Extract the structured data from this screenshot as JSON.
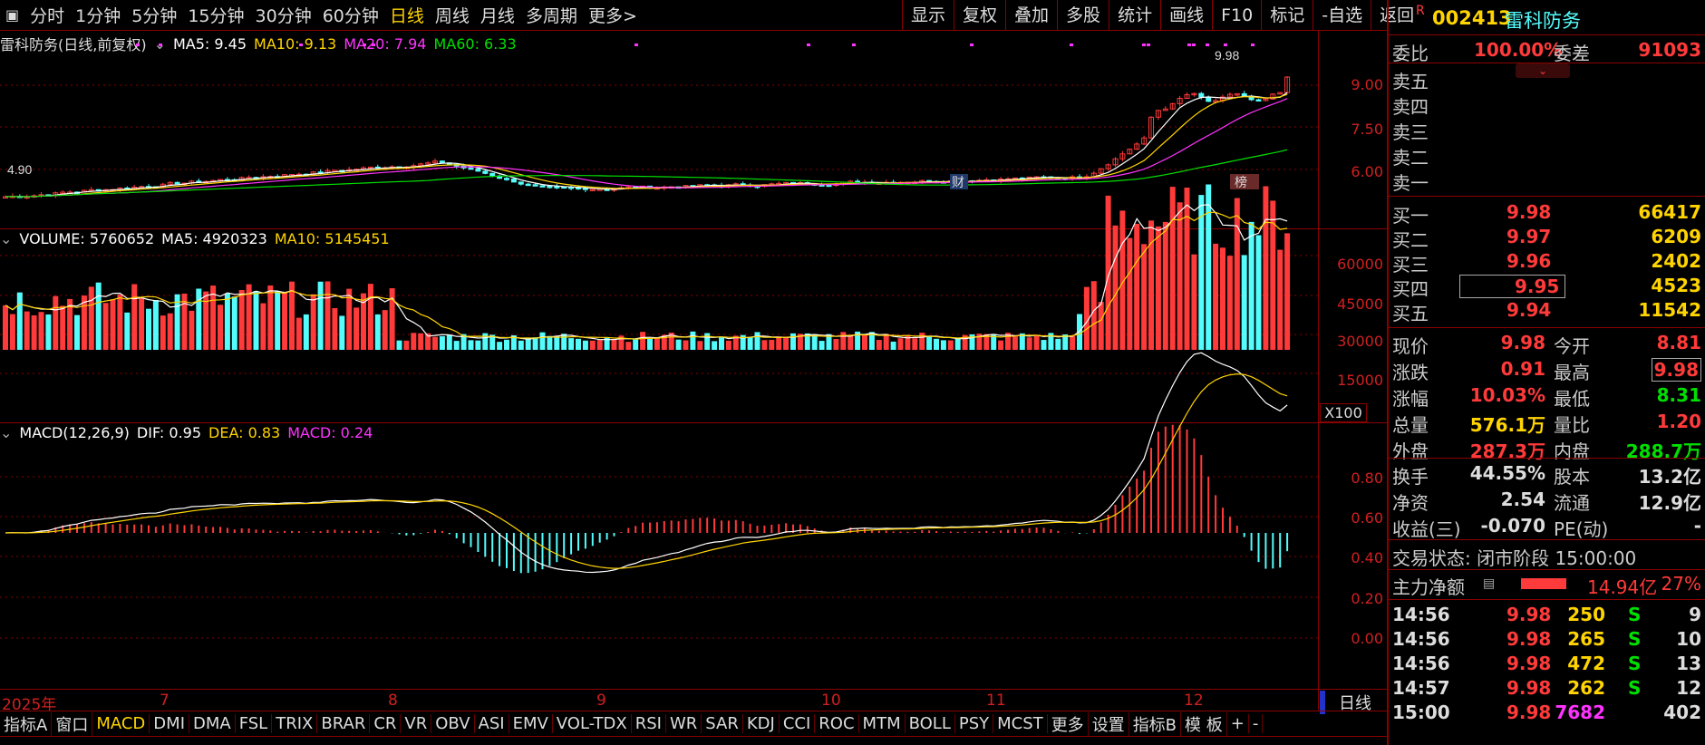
{
  "toolbar": {
    "menu_icon": "menu-square-icon",
    "periods": [
      "分时",
      "1分钟",
      "5分钟",
      "15分钟",
      "30分钟",
      "60分钟",
      "日线",
      "周线",
      "月线",
      "多周期",
      "更多>"
    ],
    "active": "日线",
    "tools": [
      "显示",
      "复权",
      "叠加",
      "多股",
      "统计",
      "画线",
      "F10",
      "标记",
      "-自选",
      "返回"
    ]
  },
  "kline": {
    "name": "雷科防务(日线,前复权)",
    "ma5": "MA5: 9.45",
    "ma10": "MA10: 9.13",
    "ma20": "MA20: 7.94",
    "ma60": "MA60: 6.33",
    "high_label": "9.98",
    "low_label": "4.90",
    "fin_mark": "财",
    "bang_mark": "榜",
    "yticks": [
      "9.00",
      "7.50",
      "6.00"
    ]
  },
  "volume": {
    "title": "VOLUME: 5760652",
    "ma5": "MA5: 4920323",
    "ma10": "MA10: 5145451",
    "yticks": [
      "60000",
      "45000",
      "30000",
      "15000"
    ],
    "unit": "X100"
  },
  "macd": {
    "title": "MACD(12,26,9)",
    "dif": "DIF: 0.95",
    "dea": "DEA: 0.83",
    "macd": "MACD: 0.24",
    "yticks": [
      "0.80",
      "0.60",
      "0.40",
      "0.20",
      "0.00"
    ]
  },
  "xaxis": {
    "labels": [
      "2025年",
      "7",
      "8",
      "9",
      "10",
      "11",
      "12"
    ],
    "period_btn": "日线"
  },
  "bottom_tabs": [
    "指标A",
    "窗口",
    "MACD",
    "DMI",
    "DMA",
    "FSL",
    "TRIX",
    "BRAR",
    "CR",
    "VR",
    "OBV",
    "ASI",
    "EMV",
    "VOL-TDX",
    "RSI",
    "WR",
    "SAR",
    "KDJ",
    "CCI",
    "ROC",
    "MTM",
    "BOLL",
    "PSY",
    "MCST",
    "更多",
    "设置",
    "指标B",
    "模 板",
    "+",
    "-"
  ],
  "bottom_active": "MACD",
  "quote": {
    "badge": "R",
    "code": "002413",
    "name": "雷科防务",
    "weibi_label": "委比",
    "weibi": "100.00%",
    "weicha_label": "委差",
    "weicha": "91093",
    "sells": [
      "卖五",
      "卖四",
      "卖三",
      "卖二",
      "卖一"
    ],
    "buys": [
      {
        "l": "买一",
        "p": "9.98",
        "v": "66417"
      },
      {
        "l": "买二",
        "p": "9.97",
        "v": "6209"
      },
      {
        "l": "买三",
        "p": "9.96",
        "v": "2402"
      },
      {
        "l": "买四",
        "p": "9.95",
        "v": "4523"
      },
      {
        "l": "买五",
        "p": "9.94",
        "v": "11542"
      }
    ],
    "stats": [
      [
        "现价",
        "9.98",
        "今开",
        "8.81"
      ],
      [
        "涨跌",
        "0.91",
        "最高",
        "9.98"
      ],
      [
        "涨幅",
        "10.03%",
        "最低",
        "8.31"
      ],
      [
        "总量",
        "576.1万",
        "量比",
        "1.20"
      ],
      [
        "外盘",
        "287.3万",
        "内盘",
        "288.7万"
      ]
    ],
    "stats2": [
      [
        "换手",
        "44.55%",
        "股本",
        "13.2亿"
      ],
      [
        "净资",
        "2.54",
        "流通",
        "12.9亿"
      ],
      [
        "收益(三)",
        "-0.070",
        "PE(动)",
        "-"
      ]
    ],
    "trade_status": "交易状态: 闭市阶段 15:00:00",
    "main_label": "主力净额",
    "main_value": "14.94亿",
    "main_pct": "27%",
    "ticks": [
      [
        "14:56",
        "9.98",
        "250",
        "S",
        "9"
      ],
      [
        "14:56",
        "9.98",
        "265",
        "S",
        "10"
      ],
      [
        "14:56",
        "9.98",
        "472",
        "S",
        "13"
      ],
      [
        "14:57",
        "9.98",
        "262",
        "S",
        "12"
      ],
      [
        "15:00",
        "9.98",
        "7682",
        "",
        "402"
      ]
    ]
  },
  "colors": {
    "up": "#ff3a3a",
    "down": "#54fcfc",
    "ma5": "#ffffff",
    "ma10": "#ffd400",
    "ma20": "#ff33ff",
    "ma60": "#00e000",
    "grid": "#8b0000"
  }
}
